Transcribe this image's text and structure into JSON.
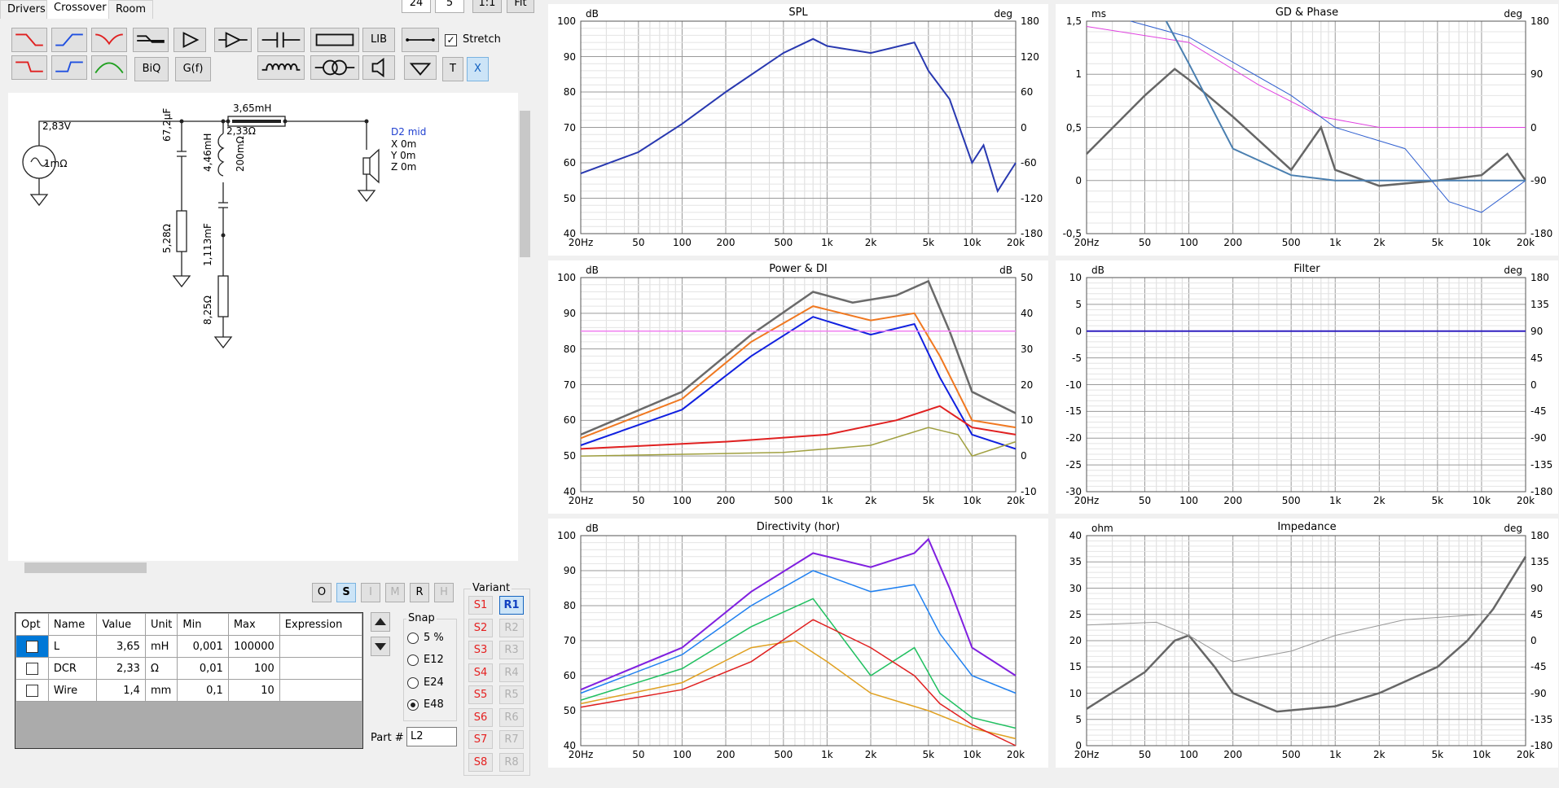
{
  "tabs": [
    "Drivers",
    "Crossover",
    "Room"
  ],
  "top_fields": {
    "a": "24",
    "b": "5",
    "c": "1:1",
    "d": "Fit"
  },
  "toolbar": {
    "lib": "LIB",
    "biq": "BiQ",
    "gf": "G(f)",
    "t": "T",
    "x": "X",
    "stretch": "Stretch"
  },
  "schematic": {
    "source_v": "2,83V",
    "source_r": "1mΩ",
    "cap1": "67,2µF",
    "ind1": "4,46mH",
    "ind1_r": "200mΩ",
    "res1": "5,28Ω",
    "cap2": "1,113mF",
    "res2": "8,25Ω",
    "ind_top": "3,65mH",
    "ind_top_r": "2,33Ω",
    "driver_name": "D2 mid",
    "driver_x": "X 0m",
    "driver_y": "Y 0m",
    "driver_z": "Z 0m"
  },
  "osimh": [
    "O",
    "S",
    "I",
    "M",
    "R",
    "H"
  ],
  "table": {
    "headers": [
      "Opt",
      "Name",
      "Value",
      "Unit",
      "Min",
      "Max",
      "Expression"
    ],
    "rows": [
      [
        "",
        "L",
        "3,65",
        "mH",
        "0,001",
        "100000",
        ""
      ],
      [
        "",
        "DCR",
        "2,33",
        "Ω",
        "0,01",
        "100",
        ""
      ],
      [
        "",
        "Wire",
        "1,4",
        "mm",
        "0,1",
        "10",
        ""
      ]
    ]
  },
  "snap": {
    "title": "Snap",
    "options": [
      "5 %",
      "E12",
      "E24",
      "E48"
    ],
    "selected": "E48"
  },
  "part": {
    "label": "Part #",
    "value": "L2"
  },
  "variant": {
    "title": "Variant",
    "s": [
      "S1",
      "S2",
      "S3",
      "S4",
      "S5",
      "S6",
      "S7",
      "S8"
    ],
    "r": [
      "R1",
      "R2",
      "R3",
      "R4",
      "R5",
      "R6",
      "R7",
      "R8"
    ]
  },
  "xticks": [
    "20Hz",
    "50",
    "100",
    "200",
    "500",
    "1k",
    "2k",
    "5k",
    "10k",
    "20k"
  ],
  "charts": [
    {
      "id": "spl",
      "title": "SPL",
      "lunit": "dB",
      "runit": "deg",
      "left": [
        "100",
        "90",
        "80",
        "70",
        "60",
        "50",
        "40"
      ],
      "right": [
        "180",
        "120",
        "60",
        "0",
        "-60",
        "-120",
        "-180"
      ]
    },
    {
      "id": "gd",
      "title": "GD & Phase",
      "lunit": "ms",
      "runit": "deg",
      "left": [
        "1,5",
        "1",
        "0,5",
        "0",
        "-0,5"
      ],
      "right": [
        "180",
        "90",
        "0",
        "-90",
        "-180"
      ]
    },
    {
      "id": "power",
      "title": "Power & DI",
      "lunit": "dB",
      "runit": "dB",
      "left": [
        "100",
        "90",
        "80",
        "70",
        "60",
        "50",
        "40"
      ],
      "right": [
        "50",
        "40",
        "30",
        "20",
        "10",
        "0",
        "-10"
      ]
    },
    {
      "id": "filter",
      "title": "Filter",
      "lunit": "dB",
      "runit": "deg",
      "left": [
        "10",
        "5",
        "0",
        "-5",
        "-10",
        "-15",
        "-20",
        "-25",
        "-30"
      ],
      "right": [
        "180",
        "135",
        "90",
        "45",
        "0",
        "-45",
        "-90",
        "-135",
        "-180"
      ]
    },
    {
      "id": "dir",
      "title": "Directivity (hor)",
      "lunit": "dB",
      "runit": "",
      "left": [
        "100",
        "90",
        "80",
        "70",
        "60",
        "50",
        "40"
      ],
      "right": []
    },
    {
      "id": "imp",
      "title": "Impedance",
      "lunit": "ohm",
      "runit": "deg",
      "left": [
        "40",
        "35",
        "30",
        "25",
        "20",
        "15",
        "10",
        "5",
        "0"
      ],
      "right": [
        "180",
        "135",
        "90",
        "45",
        "0",
        "-45",
        "-90",
        "-135",
        "-180"
      ]
    }
  ]
}
